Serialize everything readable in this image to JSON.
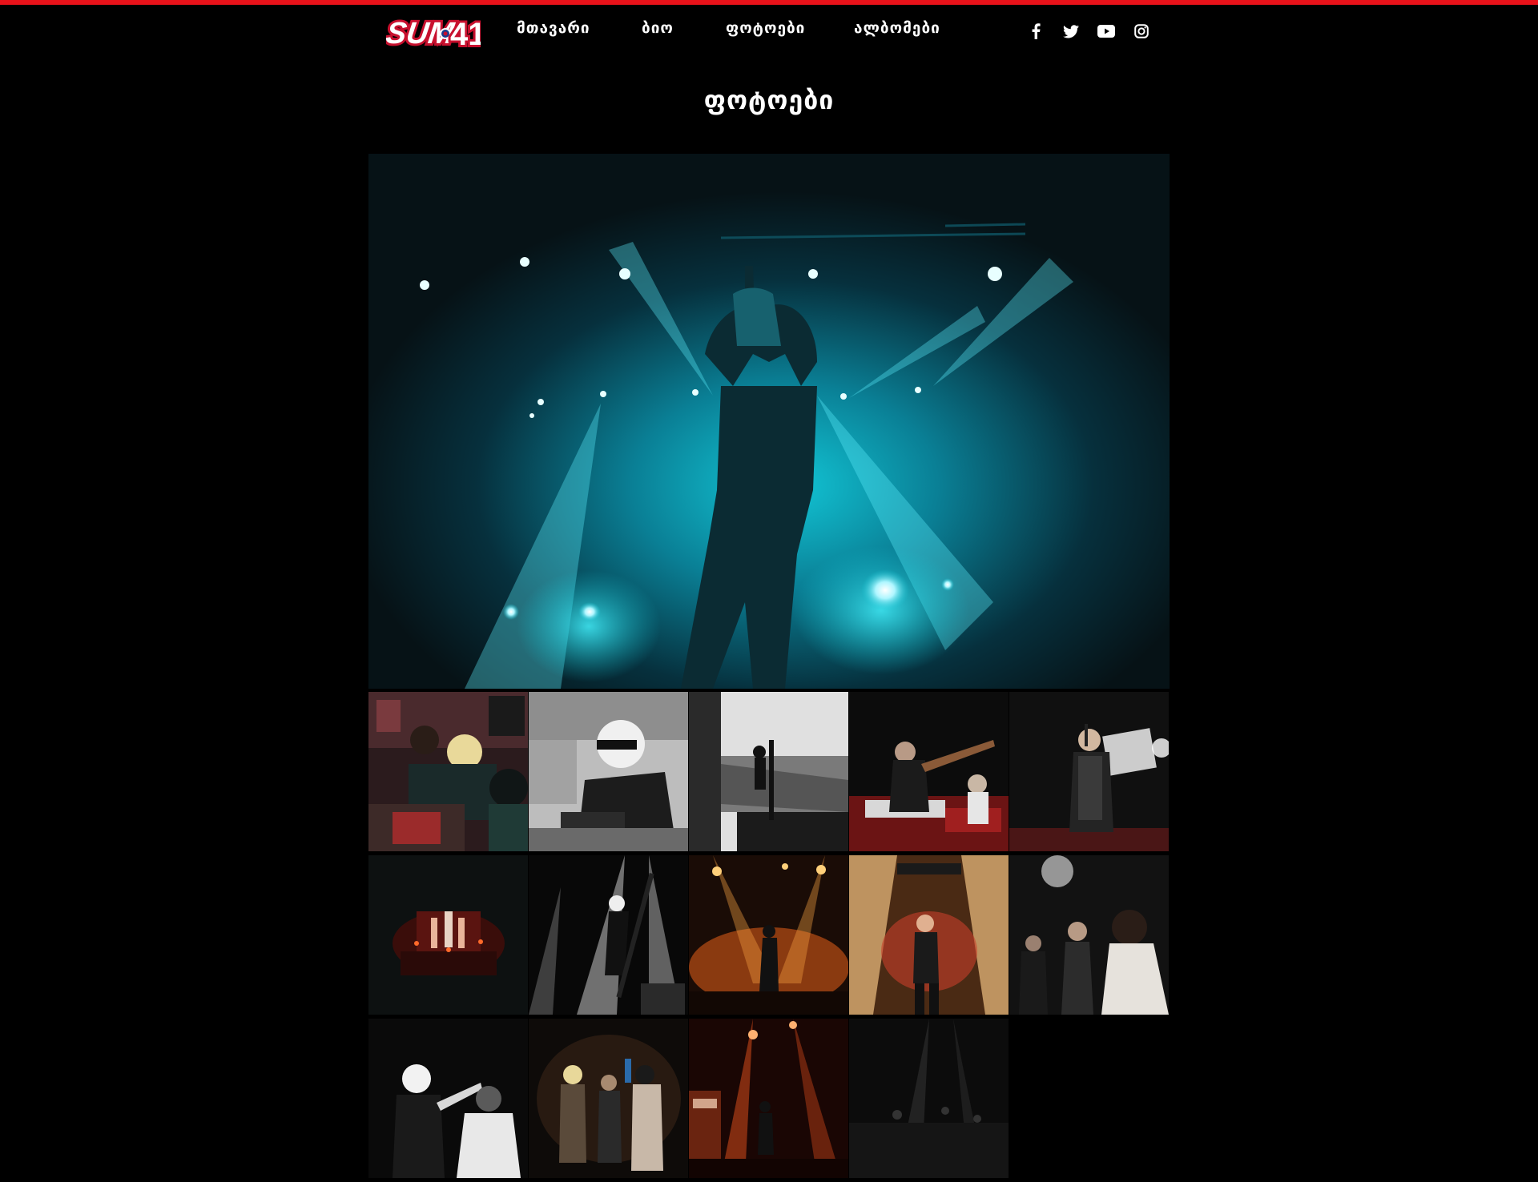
{
  "brand": {
    "logo_alt": "SUM 41",
    "accent_color": "#e8121a"
  },
  "nav": {
    "items": [
      {
        "label": "მთავარი"
      },
      {
        "label": "ბიო"
      },
      {
        "label": "ფოტოები"
      },
      {
        "label": "ალბომები"
      }
    ]
  },
  "social": {
    "icons": [
      "facebook-icon",
      "twitter-icon",
      "youtube-icon",
      "instagram-icon"
    ]
  },
  "page": {
    "title": "ფოტოები"
  },
  "gallery": {
    "hero": {
      "photo": "singer on stage with microphone, cyan stage lights"
    },
    "thumbnails": [
      {
        "photo": "band signing autographs at table"
      },
      {
        "photo": "blond member with sunglasses signing"
      },
      {
        "photo": "black and white stage view of crowd"
      },
      {
        "photo": "band performing on stage with SUM 41 sign"
      },
      {
        "photo": "singer with microphone on red stage"
      },
      {
        "photo": "wide shot of concert stage with red lights"
      },
      {
        "photo": "black and white guitarist in spotlights"
      },
      {
        "photo": "orange lit concert stage with guitarist"
      },
      {
        "photo": "singer under fiery stage lights"
      },
      {
        "photo": "band members backstage"
      },
      {
        "photo": "black and white backstage portrait"
      },
      {
        "photo": "band members in dim red light"
      },
      {
        "photo": "stage with orange beams and amplifiers"
      },
      {
        "photo": "dark concert stage view"
      }
    ]
  }
}
